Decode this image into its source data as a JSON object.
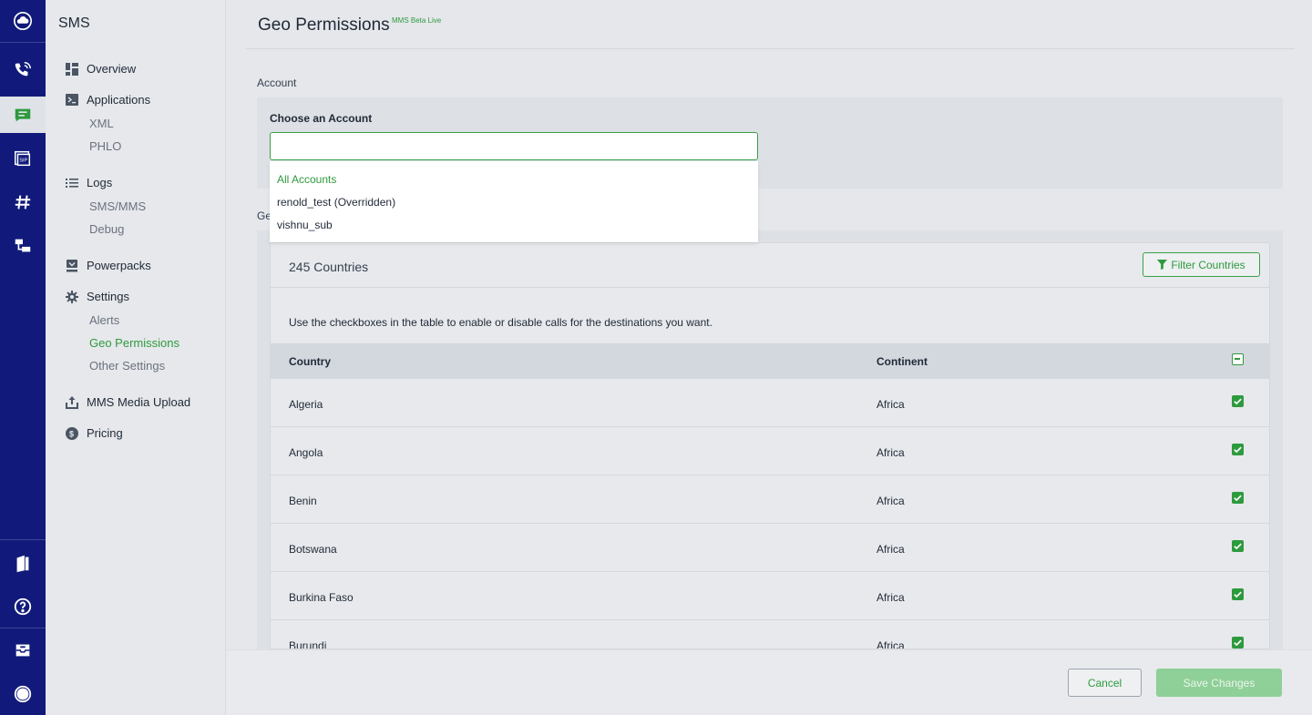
{
  "rail": {
    "icons": [
      "cloud-icon",
      "voice-icon",
      "sms-icon",
      "sip-icon",
      "number-icon",
      "zentrunk-icon",
      "docs-icon",
      "help-icon",
      "support-icon",
      "account-icon"
    ]
  },
  "sidebar": {
    "title": "SMS",
    "items": [
      {
        "label": "Overview",
        "icon": "grid-icon"
      },
      {
        "label": "Applications",
        "icon": "terminal-icon",
        "subitems": [
          "XML",
          "PHLO"
        ]
      },
      {
        "label": "Logs",
        "icon": "list-icon",
        "subitems": [
          "SMS/MMS",
          "Debug"
        ]
      },
      {
        "label": "Powerpacks",
        "icon": "powerpack-icon"
      },
      {
        "label": "Settings",
        "icon": "gear-icon",
        "subitems": [
          "Alerts",
          "Geo Permissions",
          "Other Settings"
        ]
      },
      {
        "label": "MMS Media Upload",
        "icon": "upload-icon"
      },
      {
        "label": "Pricing",
        "icon": "dollar-icon"
      }
    ],
    "active_subitem": "Geo Permissions"
  },
  "header": {
    "title": "Geo Permissions",
    "badge": "MMS Beta Live"
  },
  "account": {
    "section_label": "Account",
    "choose_label": "Choose an Account",
    "input_value": "",
    "options": [
      "All Accounts",
      "renold_test (Overridden)",
      "vishnu_sub"
    ],
    "selected_option": "All Accounts"
  },
  "geo": {
    "section_label": "Ge",
    "count_text": "245 Countries",
    "filter_label": "Filter Countries",
    "help_text": "Use the checkboxes in the table to enable or disable calls for the destinations you want.",
    "columns": [
      "Country",
      "Continent"
    ],
    "rows": [
      {
        "country": "Algeria",
        "continent": "Africa",
        "enabled": true
      },
      {
        "country": "Angola",
        "continent": "Africa",
        "enabled": true
      },
      {
        "country": "Benin",
        "continent": "Africa",
        "enabled": true
      },
      {
        "country": "Botswana",
        "continent": "Africa",
        "enabled": true
      },
      {
        "country": "Burkina Faso",
        "continent": "Africa",
        "enabled": true
      },
      {
        "country": "Burundi",
        "continent": "Africa",
        "enabled": true
      }
    ]
  },
  "footer": {
    "cancel_label": "Cancel",
    "save_label": "Save Changes"
  },
  "colors": {
    "rail": "#111a7a",
    "accent": "#2e9a3e",
    "save_disabled": "#8fcf98"
  }
}
